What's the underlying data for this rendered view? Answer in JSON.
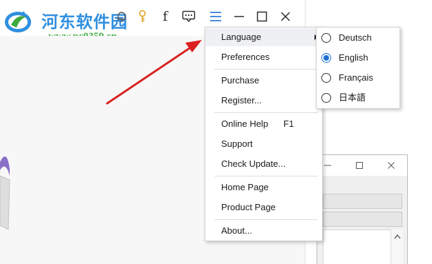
{
  "watermark": {
    "title": "河东软件园",
    "url": "www.pc0359.cn"
  },
  "toolbar": {
    "icons": [
      "bell-icon",
      "key-icon",
      "facebook-icon",
      "chat-icon",
      "menu-icon",
      "minimize-icon",
      "maximize-icon",
      "close-icon"
    ],
    "facebook_glyph": "f",
    "menu_icon_color": "#1b6fd6"
  },
  "menu": {
    "items": [
      {
        "label": "Language",
        "has_submenu": true,
        "highlighted": true
      },
      {
        "label": "Preferences"
      },
      {
        "label": "Purchase"
      },
      {
        "label": "Register..."
      },
      {
        "label": "Online Help",
        "shortcut": "F1"
      },
      {
        "label": "Support"
      },
      {
        "label": "Check Update..."
      },
      {
        "label": "Home Page"
      },
      {
        "label": "Product Page"
      },
      {
        "label": "About..."
      }
    ]
  },
  "language_submenu": {
    "options": [
      {
        "label": "Deutsch",
        "selected": false
      },
      {
        "label": "English",
        "selected": true
      },
      {
        "label": "Français",
        "selected": false
      },
      {
        "label": "日本語",
        "selected": false
      }
    ]
  },
  "annotation": {
    "arrow_color": "#d9201e"
  },
  "colors": {
    "watermark_blue": "#2f8fe0",
    "watermark_green": "#3eaa3e",
    "accent": "#1b6fd6"
  }
}
